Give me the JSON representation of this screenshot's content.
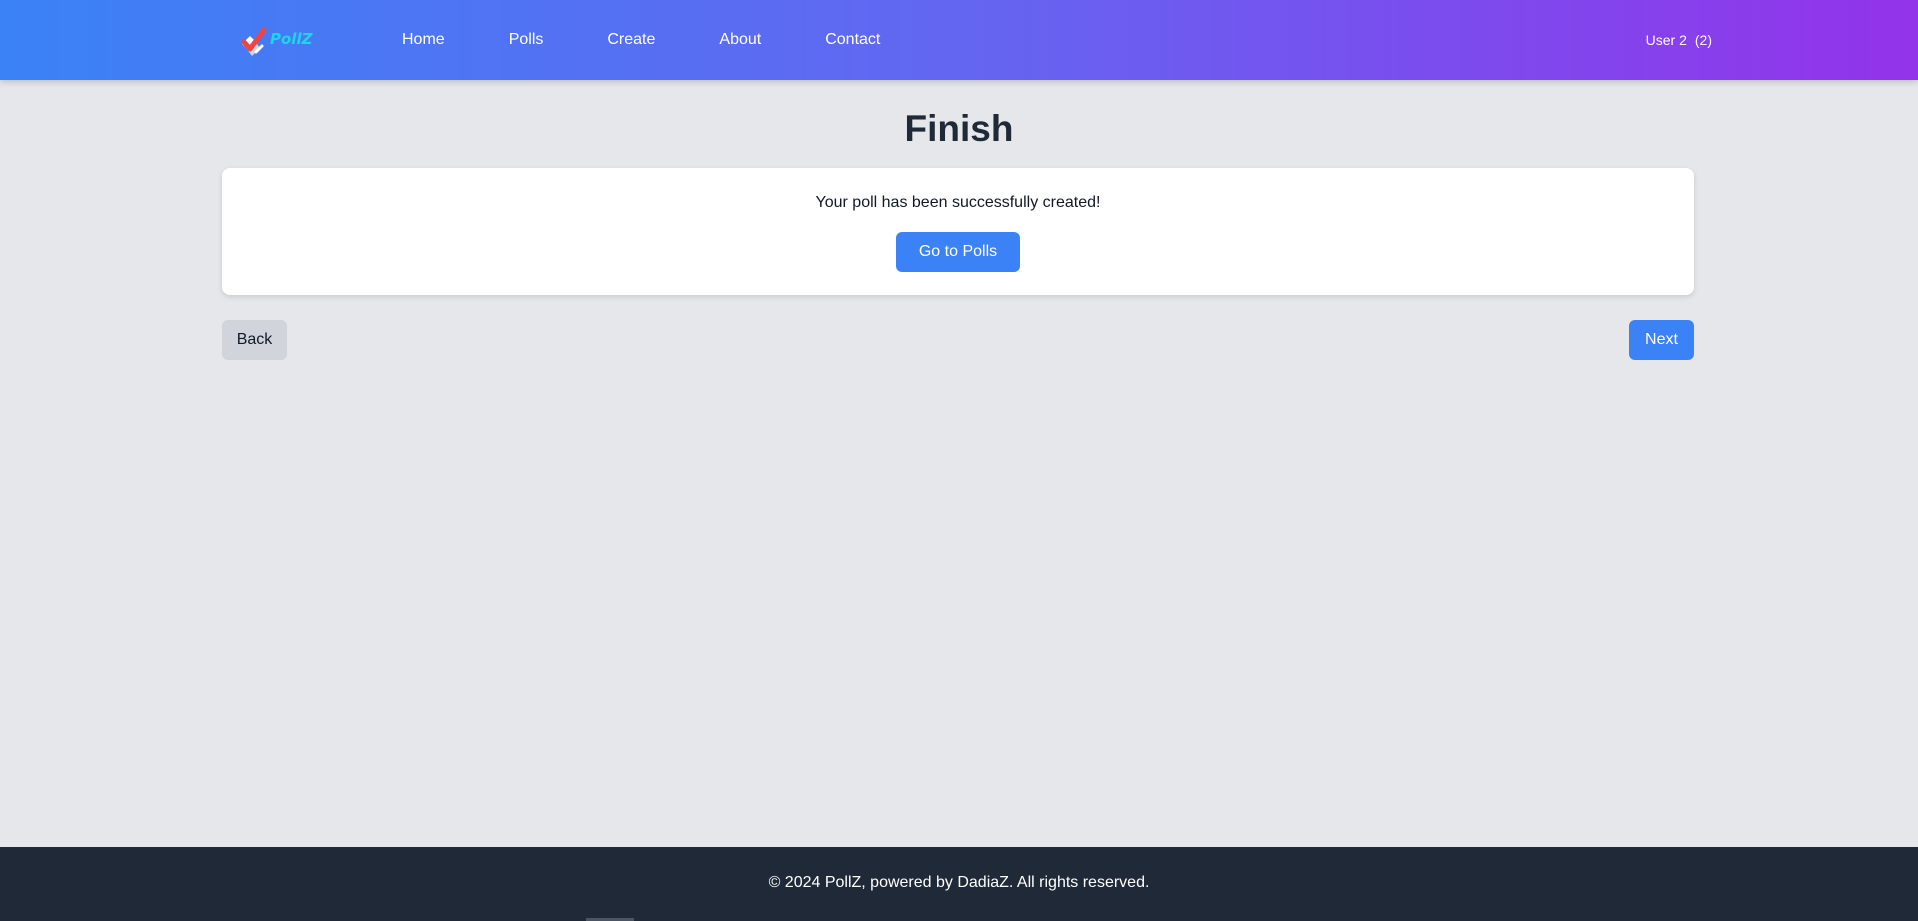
{
  "header": {
    "logo_alt": "PollZ",
    "nav": [
      "Home",
      "Polls",
      "Create",
      "About",
      "Contact"
    ],
    "user": {
      "name": "User 2",
      "count": "(2)"
    }
  },
  "main": {
    "title": "Finish",
    "card": {
      "message": "Your poll has been successfully created!",
      "button": "Go to Polls"
    },
    "back_label": "Back",
    "next_label": "Next"
  },
  "footer": {
    "text": "© 2024 PollZ, powered by DadiaZ. All rights reserved."
  },
  "colors": {
    "header_gradient_start": "#3b82f6",
    "header_gradient_end": "#9333ea",
    "primary": "#3b82f6",
    "secondary_button": "#d1d5db",
    "page_background": "#e5e7eb",
    "footer_background": "#1f2937"
  }
}
